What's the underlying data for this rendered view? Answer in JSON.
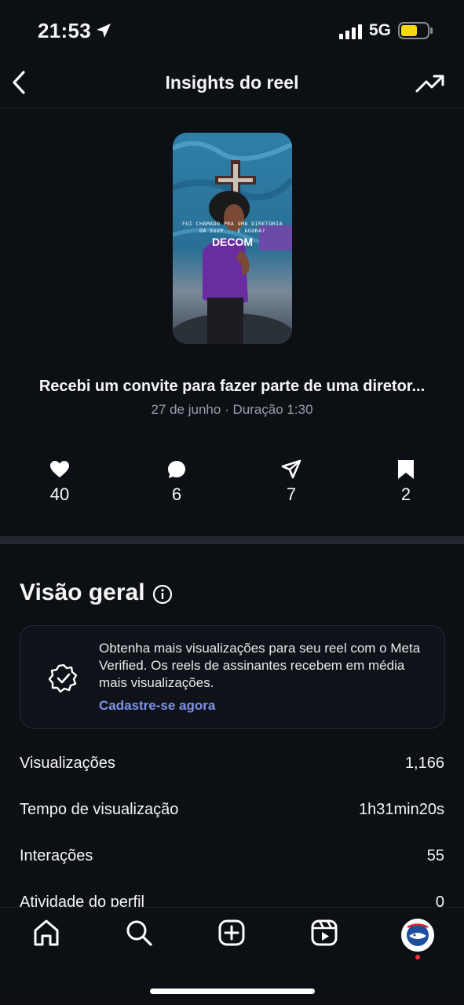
{
  "status_bar": {
    "time": "21:53",
    "network": "5G",
    "battery_color": "#f5d90a"
  },
  "nav": {
    "title": "Insights do reel",
    "back_icon": "chevron-left-icon",
    "right_icon": "trending-up-icon"
  },
  "reel": {
    "thumbnail_text_small": "FUI CHAMADO PRA UMA DIRETORIA DA SSVP... E AGORA?",
    "thumbnail_text_big": "DECOM",
    "caption": "Recebi um convite para fazer parte de uma diretor...",
    "date": "27 de junho",
    "separator": " · ",
    "duration": "Duração 1:30"
  },
  "stats": [
    {
      "icon": "heart-icon",
      "value": "40"
    },
    {
      "icon": "comment-icon",
      "value": "6"
    },
    {
      "icon": "send-icon",
      "value": "7"
    },
    {
      "icon": "bookmark-icon",
      "value": "2"
    }
  ],
  "overview": {
    "title": "Visão geral",
    "promo_text": "Obtenha mais visualizações para seu reel com o Meta Verified. Os reels de assinantes recebem em média mais visualizações.",
    "promo_link": "Cadastre-se agora",
    "link_color": "#7d93e8",
    "metrics": [
      {
        "label": "Visualizações",
        "value": "1,166"
      },
      {
        "label": "Tempo de visualização",
        "value": "1h31min20s"
      },
      {
        "label": "Interações",
        "value": "55"
      },
      {
        "label": "Atividade do perfil",
        "value": "0"
      }
    ]
  },
  "tab_bar": {
    "items": [
      "home-icon",
      "search-icon",
      "create-icon",
      "reels-icon",
      "profile-avatar"
    ],
    "notification_color": "#ff3040"
  }
}
